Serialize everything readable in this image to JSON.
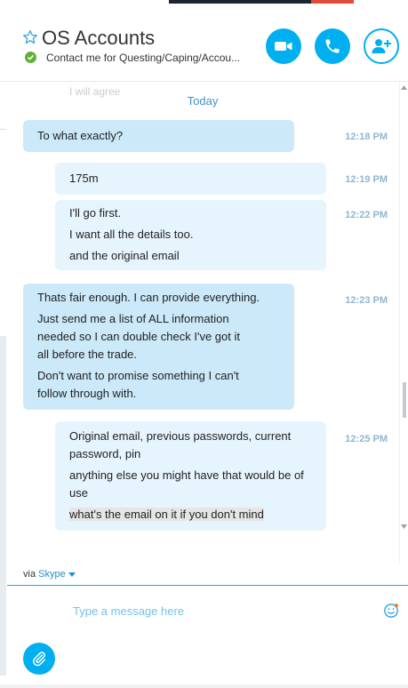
{
  "header": {
    "title": "OS Accounts",
    "mood": "Contact me for Questing/Caping/Accou...",
    "status": "online"
  },
  "chat": {
    "ghost_text": "I will agree",
    "day_label": "Today",
    "messages": [
      {
        "dir": "in",
        "time": "12:18 PM",
        "lines": [
          "To what exactly?"
        ]
      },
      {
        "dir": "out",
        "time": "12:19 PM",
        "lines": [
          "175m"
        ]
      },
      {
        "dir": "out",
        "time": "12:22 PM",
        "lines": [
          "I'll go first.",
          "I want all the details too.",
          "and the original email"
        ]
      },
      {
        "dir": "in",
        "time": "12:23 PM",
        "lines": [
          "Thats fair enough. I can provide everything.",
          "Just send me a list of ALL information needed so I can double check I've got it all before the trade.",
          "Don't want to promise something I can't follow through with."
        ]
      },
      {
        "dir": "out",
        "time": "12:25 PM",
        "lines": [
          "Original email, previous passwords, current password, pin",
          "anything else you might have that would be of use",
          "what's the email on it if you don't mind"
        ]
      }
    ]
  },
  "footer": {
    "via_label": "via",
    "via_link": "Skype",
    "input_placeholder": "Type a message here"
  },
  "icons": {
    "favorite": "star-icon",
    "video": "video-camera-icon",
    "call": "phone-icon",
    "add_people": "add-person-icon",
    "emoji": "emoticon-icon",
    "attach": "paperclip-icon"
  },
  "colors": {
    "accent": "#00aff0",
    "incoming_bubble": "#cbe9f8",
    "outgoing_bubble": "#e6f4fd",
    "online": "#5fb236",
    "timestamp": "#8fb6cf"
  }
}
